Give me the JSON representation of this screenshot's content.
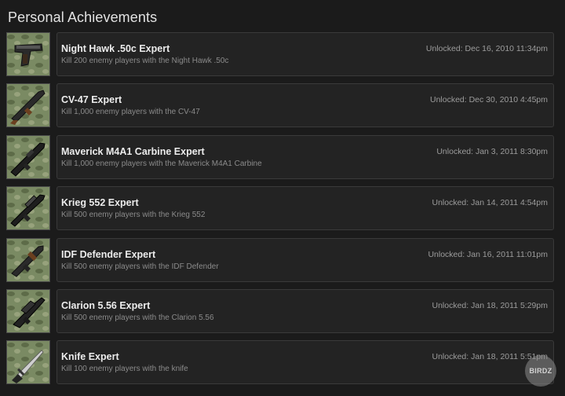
{
  "page": {
    "title": "Personal Achievements"
  },
  "achievements": [
    {
      "icon": "pistol-icon",
      "name": "Night Hawk .50c Expert",
      "description": "Kill 200 enemy players with the Night Hawk .50c",
      "unlocked": "Unlocked: Dec 16, 2010 11:34pm"
    },
    {
      "icon": "assault-rifle-icon",
      "name": "CV-47 Expert",
      "description": "Kill 1,000 enemy players with the CV-47",
      "unlocked": "Unlocked: Dec 30, 2010 4:45pm"
    },
    {
      "icon": "carbine-icon",
      "name": "Maverick M4A1 Carbine Expert",
      "description": "Kill 1,000 enemy players with the Maverick M4A1 Carbine",
      "unlocked": "Unlocked: Jan 3, 2011 8:30pm"
    },
    {
      "icon": "scoped-rifle-icon",
      "name": "Krieg 552 Expert",
      "description": "Kill 500 enemy players with the Krieg 552",
      "unlocked": "Unlocked: Jan 14, 2011 4:54pm"
    },
    {
      "icon": "assault-rifle-icon",
      "name": "IDF Defender Expert",
      "description": "Kill 500 enemy players with the IDF Defender",
      "unlocked": "Unlocked: Jan 16, 2011 11:01pm"
    },
    {
      "icon": "bullpup-rifle-icon",
      "name": "Clarion 5.56 Expert",
      "description": "Kill 500 enemy players with the Clarion 5.56",
      "unlocked": "Unlocked: Jan 18, 2011 5:29pm"
    },
    {
      "icon": "knife-icon",
      "name": "Knife Expert",
      "description": "Kill 100 enemy players with the knife",
      "unlocked": "Unlocked: Jan 18, 2011 5:51pm"
    }
  ],
  "watermark": {
    "text": "BIRDZ"
  },
  "colors": {
    "background": "#1b1b1b",
    "card": "#232323",
    "card_border": "#3a3a3a",
    "camo_green": "#6f7f5a"
  }
}
